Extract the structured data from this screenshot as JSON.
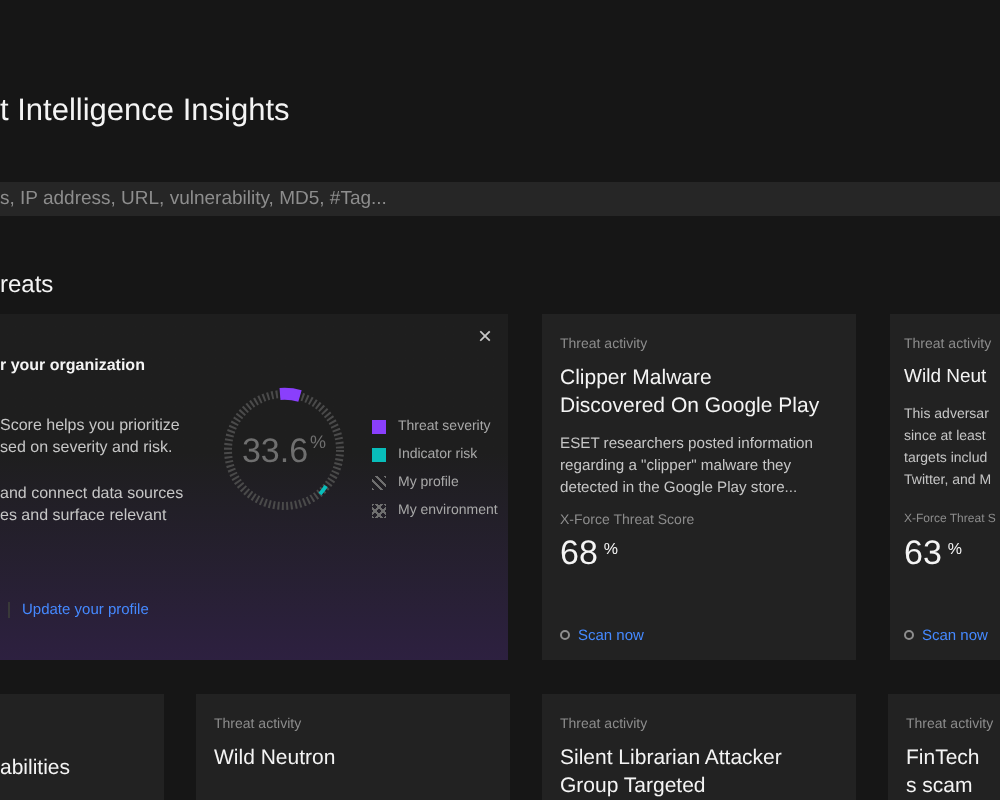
{
  "page_title": "t Intelligence Insights",
  "search": {
    "placeholder": "s, IP address, URL, vulnerability, MD5, #Tag..."
  },
  "section_title": "reats",
  "intro_card": {
    "title": "r your organization",
    "close": "×",
    "paragraphs": [
      "Score helps you prioritize\nsed on severity and risk.",
      "and connect data sources\nes and surface relevant"
    ],
    "link": "Update your profile",
    "score": "33.6",
    "unit": "%",
    "legend": [
      {
        "label": "Threat severity",
        "kind": "solid",
        "color": "#8a3ffc"
      },
      {
        "label": "Indicator risk",
        "kind": "solid",
        "color": "#08bdba"
      },
      {
        "label": "My profile",
        "kind": "hatched"
      },
      {
        "label": "My environment",
        "kind": "crossed"
      }
    ]
  },
  "cards": [
    {
      "label": "Threat activity",
      "title": "Clipper Malware Discovered On Google Play",
      "lines": [
        "ESET researchers posted information",
        "regarding a \"clipper\" malware they",
        "detected in the Google Play store..."
      ],
      "score_label": "X-Force Threat Score",
      "score": "68",
      "unit": "%",
      "action": "Scan now"
    },
    {
      "label": "Threat activity",
      "title": "Wild Neut",
      "lines": [
        "This adversar",
        "since at least",
        "targets includ",
        "Twitter, and M"
      ],
      "score_label": "X-Force Threat S",
      "score": "63",
      "unit": "%",
      "action": "Scan now"
    }
  ],
  "more_cards": [
    {
      "title": "abilities"
    },
    {
      "label": "Threat activity",
      "title": "Wild Neutron"
    },
    {
      "label": "Threat activity",
      "title": "Silent Librarian Attacker Group Targeted"
    },
    {
      "label": "Threat activity",
      "title": "FinTech s scam"
    }
  ]
}
